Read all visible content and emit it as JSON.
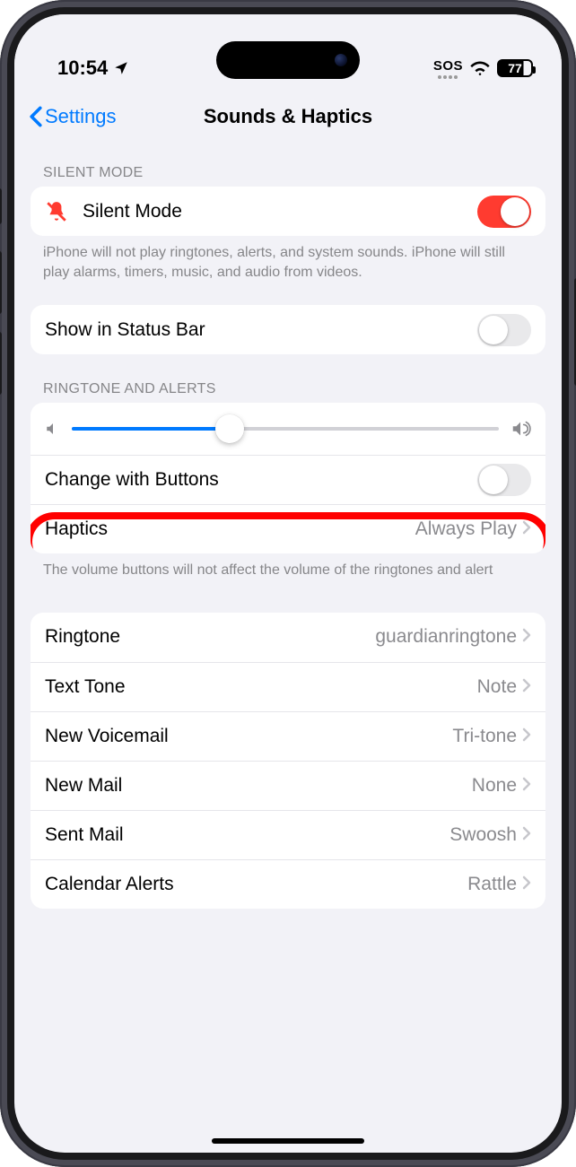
{
  "status": {
    "time": "10:54",
    "sos": "SOS",
    "battery": "77"
  },
  "nav": {
    "back_label": "Settings",
    "title": "Sounds & Haptics"
  },
  "silent_section": {
    "header": "SILENT MODE",
    "row_label": "Silent Mode",
    "enabled": true,
    "footer": "iPhone will not play ringtones, alerts, and system sounds. iPhone will still play alarms, timers, music, and audio from videos."
  },
  "status_bar_row": {
    "label": "Show in Status Bar",
    "enabled": false
  },
  "ringtone_section": {
    "header": "RINGTONE AND ALERTS",
    "slider_percent": 37,
    "change_buttons_label": "Change with Buttons",
    "change_buttons_enabled": false,
    "haptics_label": "Haptics",
    "haptics_value": "Always Play",
    "footer": "The volume buttons will not affect the volume of the ringtones and alert"
  },
  "sounds_list": [
    {
      "label": "Ringtone",
      "value": "guardianringtone"
    },
    {
      "label": "Text Tone",
      "value": "Note"
    },
    {
      "label": "New Voicemail",
      "value": "Tri-tone"
    },
    {
      "label": "New Mail",
      "value": "None"
    },
    {
      "label": "Sent Mail",
      "value": "Swoosh"
    },
    {
      "label": "Calendar Alerts",
      "value": "Rattle"
    }
  ]
}
